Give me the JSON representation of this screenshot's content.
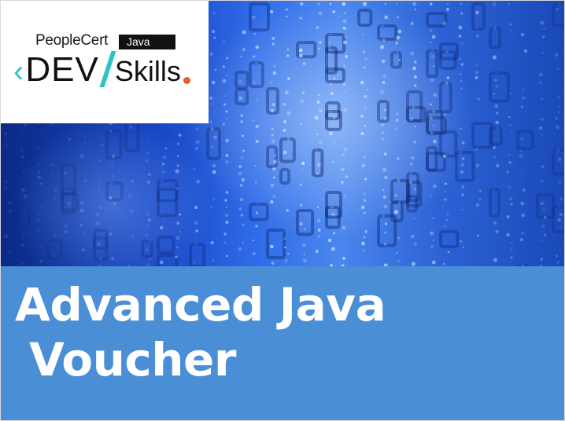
{
  "logo": {
    "people": "People",
    "cert": "Cert",
    "track": "Java",
    "dev": "DEV",
    "skills": "Skills",
    "accent_teal": "#2ec4c6",
    "accent_orange": "#f05a28",
    "icons": [
      "chevron-left-icon",
      "slash-icon",
      "dot-icon"
    ]
  },
  "title": {
    "line1": "Advanced Java",
    "line2": "Voucher"
  },
  "colors": {
    "band": "#4a8ed6",
    "background_blue": "#1846c4",
    "title_text": "#ffffff"
  }
}
